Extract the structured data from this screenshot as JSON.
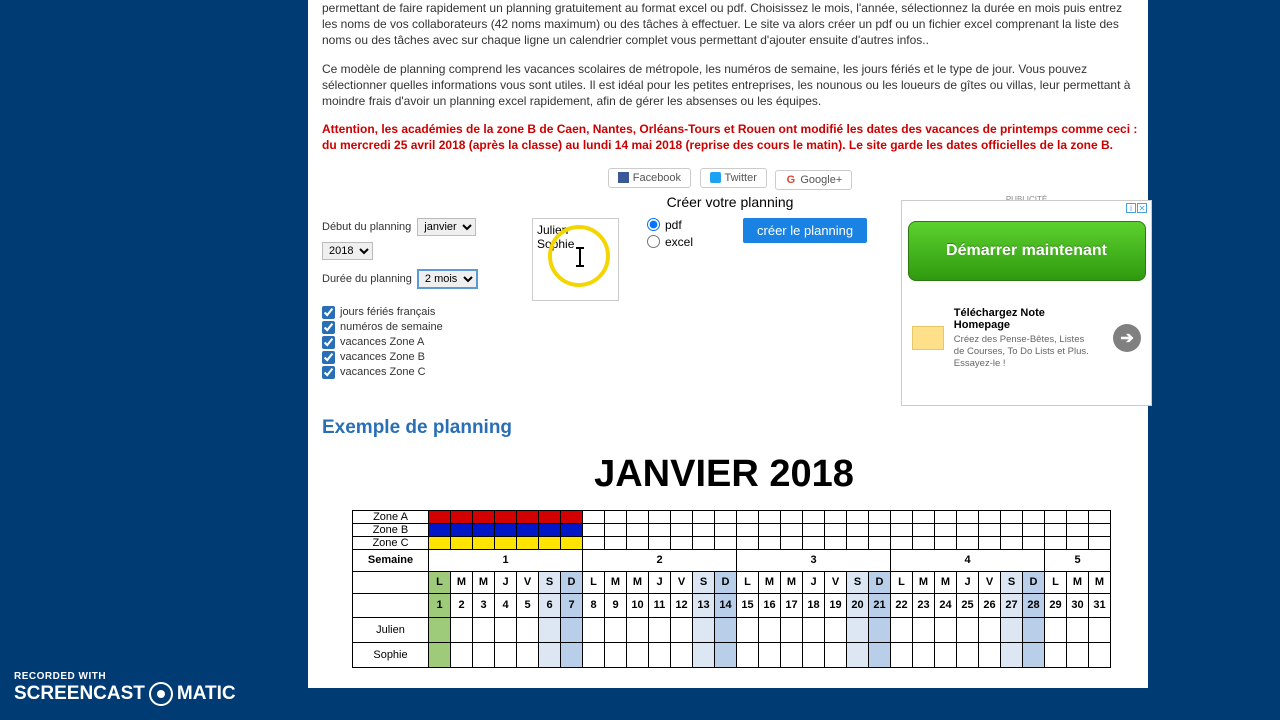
{
  "intro": {
    "p1_part": "permettant de faire rapidement un planning gratuitement au format excel ou pdf. Choisissez le mois, l'année, sélectionnez la durée en mois puis entrez les noms de vos collaborateurs (42 noms maximum) ou des tâches à effectuer. Le site va alors créer un pdf ou un fichier excel comprenant la liste des noms ou des tâches avec sur chaque ligne un calendrier complet vous permettant d'ajouter ensuite d'autres infos..",
    "p2": "Ce modèle de planning comprend les vacances scolaires de métropole, les numéros de semaine, les jours fériés et le type de jour. Vous pouvez sélectionner quelles informations vous sont utiles. Il est idéal pour les petites entreprises, les nounous ou les loueurs de gîtes ou villas, leur permettant à moindre frais d'avoir un planning excel rapidement, afin de gérer les absenses ou les équipes.",
    "warning": "Attention, les académies de la zone B de Caen, Nantes, Orléans-Tours et Rouen ont modifié les dates des vacances de printemps comme ceci : du mercredi 25 avril 2018 (après la classe) au lundi 14 mai 2018 (reprise des cours le matin). Le site garde les dates officielles de la zone B."
  },
  "share": {
    "facebook": "Facebook",
    "twitter": "Twitter",
    "google": "Google+"
  },
  "form": {
    "heading": "Créer votre planning",
    "start_label": "Début du planning",
    "start_month": "janvier",
    "start_year": "2018",
    "duration_label": "Durée du planning",
    "duration_value": "2 mois",
    "chk_feries": "jours fériés français",
    "chk_semaine": "numéros de semaine",
    "chk_zoneA": "vacances Zone A",
    "chk_zoneB": "vacances Zone B",
    "chk_zoneC": "vacances Zone C",
    "names_value": "Julien\nSophie",
    "fmt_pdf": "pdf",
    "fmt_excel": "excel",
    "create_label": "créer le planning"
  },
  "ad": {
    "publicite": "PUBLICITÉ",
    "green_label": "Démarrer maintenant",
    "title": "Téléchargez Note Homepage",
    "desc": "Créez des Pense-Bêtes, Listes de Courses, To Do Lists et Plus. Essayez-le !"
  },
  "example_heading": "Exemple de planning",
  "big_month": "JANVIER 2018",
  "calendar": {
    "zone_labels": [
      "Zone A",
      "Zone B",
      "Zone C"
    ],
    "semaine_label": "Semaine",
    "week_numbers": [
      "1",
      "2",
      "3",
      "4",
      "5"
    ],
    "week_spans": [
      7,
      7,
      7,
      7,
      3
    ],
    "day_letters": [
      "L",
      "M",
      "M",
      "J",
      "V",
      "S",
      "D",
      "L",
      "M",
      "M",
      "J",
      "V",
      "S",
      "D",
      "L",
      "M",
      "M",
      "J",
      "V",
      "S",
      "D",
      "L",
      "M",
      "M",
      "J",
      "V",
      "S",
      "D",
      "L",
      "M",
      "M"
    ],
    "day_numbers": [
      "1",
      "2",
      "3",
      "4",
      "5",
      "6",
      "7",
      "8",
      "9",
      "10",
      "11",
      "12",
      "13",
      "14",
      "15",
      "16",
      "17",
      "18",
      "19",
      "20",
      "21",
      "22",
      "23",
      "24",
      "25",
      "26",
      "27",
      "28",
      "29",
      "30",
      "31"
    ],
    "names": [
      "Julien",
      "Sophie"
    ]
  },
  "watermark": {
    "line1": "RECORDED WITH",
    "brand_a": "SCREENCAST",
    "brand_b": "MATIC"
  }
}
